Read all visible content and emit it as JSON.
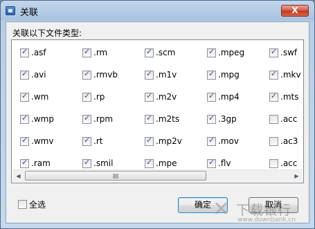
{
  "window": {
    "title": "关联",
    "close_label": "X"
  },
  "prompt": "关联以下文件类型:",
  "columns": [
    [
      {
        "label": ".asf",
        "checked": true
      },
      {
        "label": ".avi",
        "checked": true
      },
      {
        "label": ".wm",
        "checked": true
      },
      {
        "label": ".wmp",
        "checked": true
      },
      {
        "label": ".wmv",
        "checked": true
      },
      {
        "label": ".ram",
        "checked": true
      }
    ],
    [
      {
        "label": ".rm",
        "checked": true
      },
      {
        "label": ".rmvb",
        "checked": true
      },
      {
        "label": ".rp",
        "checked": true
      },
      {
        "label": ".rpm",
        "checked": true
      },
      {
        "label": ".rt",
        "checked": true
      },
      {
        "label": ".smil",
        "checked": true
      }
    ],
    [
      {
        "label": ".scm",
        "checked": true
      },
      {
        "label": ".m1v",
        "checked": true
      },
      {
        "label": ".m2v",
        "checked": true
      },
      {
        "label": ".m2ts",
        "checked": true
      },
      {
        "label": ".mp2v",
        "checked": true
      },
      {
        "label": ".mpe",
        "checked": true
      }
    ],
    [
      {
        "label": ".mpeg",
        "checked": true
      },
      {
        "label": ".mpg",
        "checked": true
      },
      {
        "label": ".mp4",
        "checked": true
      },
      {
        "label": ".3gp",
        "checked": true
      },
      {
        "label": ".mov",
        "checked": true
      },
      {
        "label": ".flv",
        "checked": true
      }
    ],
    [
      {
        "label": ".swf",
        "checked": true
      },
      {
        "label": ".mkv",
        "checked": true
      },
      {
        "label": ".mts",
        "checked": true
      },
      {
        "label": ".acc",
        "checked": false
      },
      {
        "label": ".ac3",
        "checked": false
      },
      {
        "label": ".acc",
        "checked": false
      }
    ]
  ],
  "select_all": {
    "label": "全选",
    "checked": false
  },
  "buttons": {
    "ok": "确定",
    "cancel": "取消"
  },
  "watermark": {
    "text": "下载银行",
    "url": "www.downbank.cn"
  }
}
